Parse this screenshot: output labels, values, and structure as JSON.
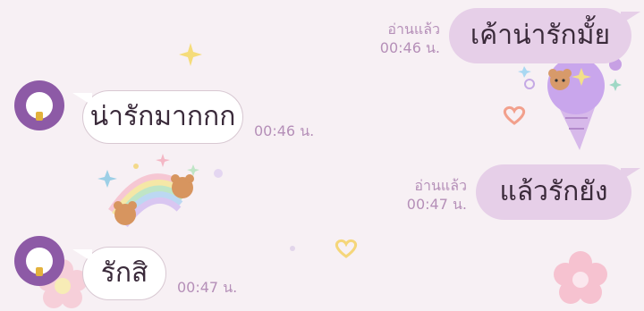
{
  "messages": [
    {
      "side": "out",
      "text": "เค้าน่ารักมั้ย",
      "read": "อ่านแล้ว",
      "time": "00:46 น."
    },
    {
      "side": "in",
      "text": "น่ารักมากกก",
      "time": "00:46 น."
    },
    {
      "side": "out",
      "text": "แล้วรักยัง",
      "read": "อ่านแล้ว",
      "time": "00:47 น."
    },
    {
      "side": "in",
      "text": "รักสิ",
      "time": "00:47 น."
    }
  ],
  "colors": {
    "background": "#f7f0f4",
    "outgoing_bubble": "#e6cfe8",
    "incoming_bubble": "#ffffff",
    "avatar": "#8d5aa6",
    "meta_text": "#b58fb8"
  },
  "icons": {
    "avatar": "profile-avatar-icon",
    "sticker_1": "ice-cream-bear-sticker",
    "sticker_2": "rainbow-bears-sticker"
  }
}
